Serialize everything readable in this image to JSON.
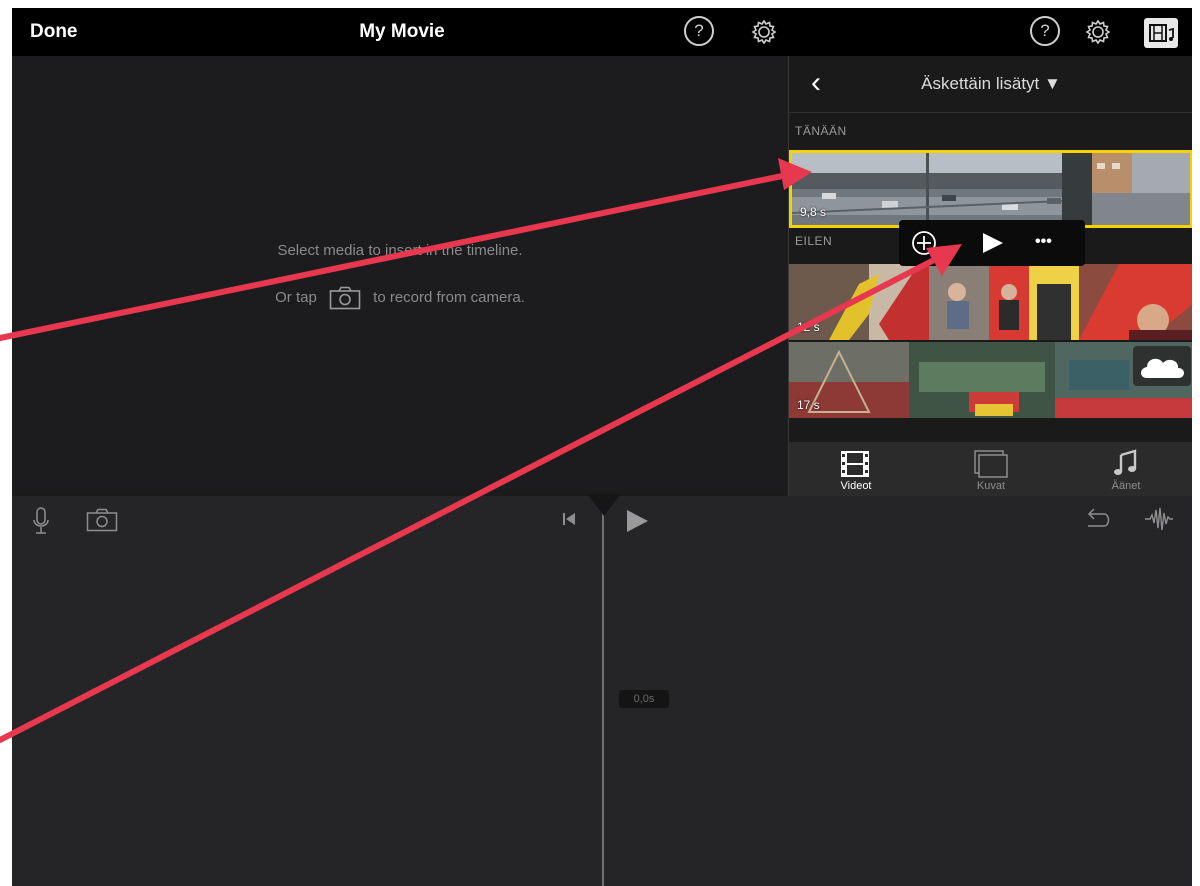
{
  "topbar": {
    "done_label": "Done",
    "title": "My Movie",
    "help_symbol": "?",
    "icons": [
      "help-icon",
      "settings-icon",
      "media-library-icon"
    ]
  },
  "preview": {
    "hint_line1": "Select media to insert in the timeline.",
    "hint_line2_before": "Or tap",
    "hint_line2_after": "to record from camera."
  },
  "media_panel": {
    "back_symbol": "‹",
    "album_title": "Äskettäin lisätyt ▼",
    "sections": [
      {
        "label": "TÄNÄÄN",
        "clips": [
          {
            "duration": "9,8 s",
            "selected": true
          }
        ]
      },
      {
        "label": "EILEN",
        "clips": [
          {
            "duration": "12 s",
            "selected": false
          },
          {
            "duration": "17 s",
            "selected": false,
            "in_cloud": true
          }
        ]
      }
    ],
    "clip_actions": [
      "add-clip",
      "play-clip",
      "more-options"
    ],
    "more_symbol": "•••",
    "tabs": [
      {
        "label": "Videot",
        "active": true
      },
      {
        "label": "Kuvat",
        "active": false
      },
      {
        "label": "Äänet",
        "active": false
      }
    ]
  },
  "timeline": {
    "time_label": "0,0s"
  },
  "colors": {
    "selection": "#f6d100",
    "annotation_arrow": "#e8384f",
    "background": "#1b1b1c"
  }
}
